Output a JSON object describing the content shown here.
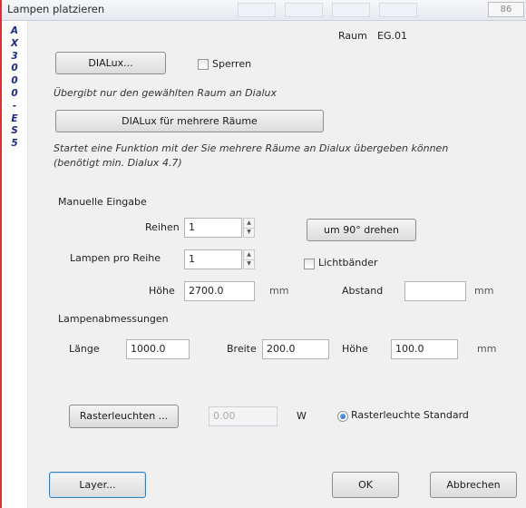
{
  "window": {
    "title": "Lampen platzieren",
    "corner_value": "86"
  },
  "side_strip": {
    "letters": [
      "A",
      "X",
      "3",
      "0",
      "0",
      "0",
      "-",
      "E",
      "S",
      "5"
    ]
  },
  "raum": {
    "label": "Raum",
    "value": "EG.01"
  },
  "dialux": {
    "button_label": "DIALux...",
    "sperren_label": "Sperren",
    "sperren_checked": false,
    "description": "Übergibt nur den gewählten Raum an Dialux",
    "multi_button_label": "DIALux für mehrere Räume",
    "multi_description_line1": "Startet eine Funktion mit der Sie mehrere Räume an Dialux übergeben können",
    "multi_description_line2": "(benötigt min. Dialux 4.7)"
  },
  "manual": {
    "heading": "Manuelle Eingabe",
    "reihen_label": "Reihen",
    "reihen_value": "1",
    "lampen_pro_reihe_label": "Lampen pro Reihe",
    "lampen_pro_reihe_value": "1",
    "hoehe_label": "Höhe",
    "hoehe_value": "2700.0",
    "hoehe_unit": "mm",
    "rotate_button_label": "um 90° drehen",
    "lichtbaender_label": "Lichtbänder",
    "lichtbaender_checked": false,
    "abstand_label": "Abstand",
    "abstand_value": "",
    "abstand_unit": "mm"
  },
  "dimensions": {
    "heading": "Lampenabmessungen",
    "laenge_label": "Länge",
    "laenge_value": "1000.0",
    "breite_label": "Breite",
    "breite_value": "200.0",
    "hoehe_label": "Höhe",
    "hoehe_value": "100.0",
    "unit": "mm"
  },
  "raster": {
    "button_label": "Rasterleuchten ...",
    "watt_value": "0.00",
    "watt_unit": "W",
    "standard_label": "Rasterleuchte Standard",
    "standard_selected": true
  },
  "footer": {
    "layer_label": "Layer...",
    "ok_label": "OK",
    "cancel_label": "Abbrechen"
  },
  "colors": {
    "edge": "#d93030",
    "strip_letters": "#1a2a80",
    "dialog_bg": "#f0f0f0"
  }
}
